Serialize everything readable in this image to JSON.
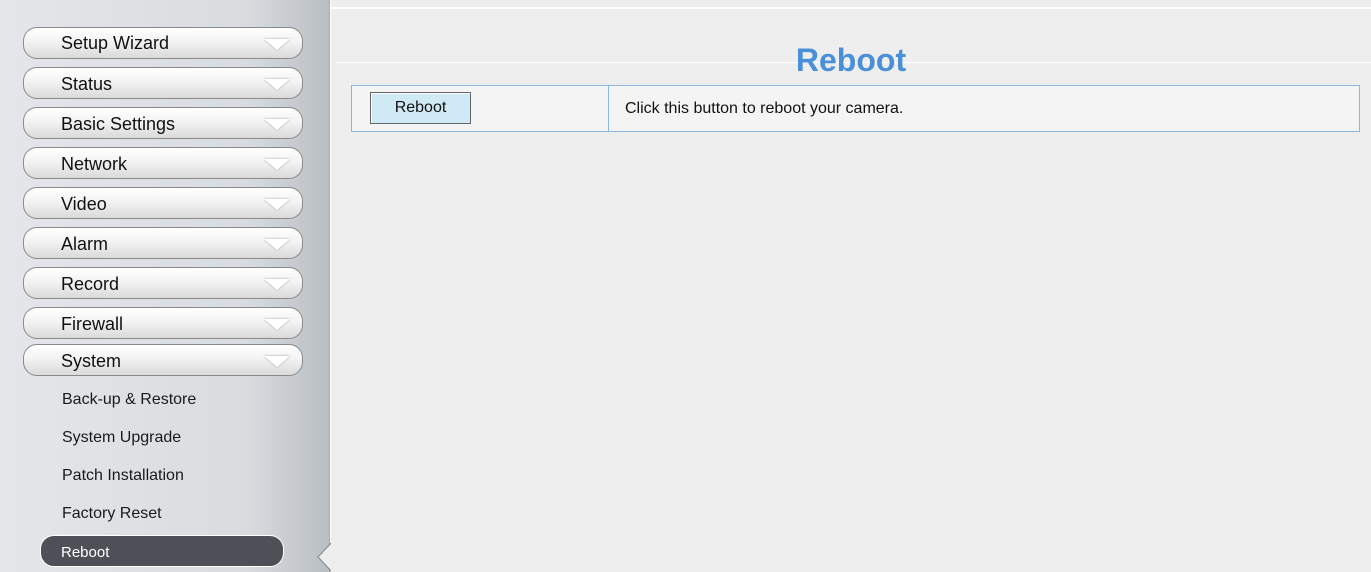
{
  "sidebar": {
    "menu": [
      {
        "label": "Setup Wizard"
      },
      {
        "label": "Status"
      },
      {
        "label": "Basic Settings"
      },
      {
        "label": "Network"
      },
      {
        "label": "Video"
      },
      {
        "label": "Alarm"
      },
      {
        "label": "Record"
      },
      {
        "label": "Firewall"
      },
      {
        "label": "System"
      }
    ],
    "system_submenu": [
      {
        "label": "Back-up & Restore"
      },
      {
        "label": "System Upgrade"
      },
      {
        "label": "Patch Installation"
      },
      {
        "label": "Factory Reset"
      },
      {
        "label": "Reboot",
        "active": true
      }
    ]
  },
  "main": {
    "title": "Reboot",
    "row": {
      "button_label": "Reboot",
      "description": "Click this button to reboot your camera."
    }
  },
  "colors": {
    "title_blue": "#4a90d9",
    "button_bg": "#cfeaf5",
    "table_border": "#8cb7dc",
    "active_item_bg": "#4d5157"
  },
  "icons": {
    "menu_expand": "chevron-down-icon",
    "active_pointer": "caret-left-icon"
  }
}
